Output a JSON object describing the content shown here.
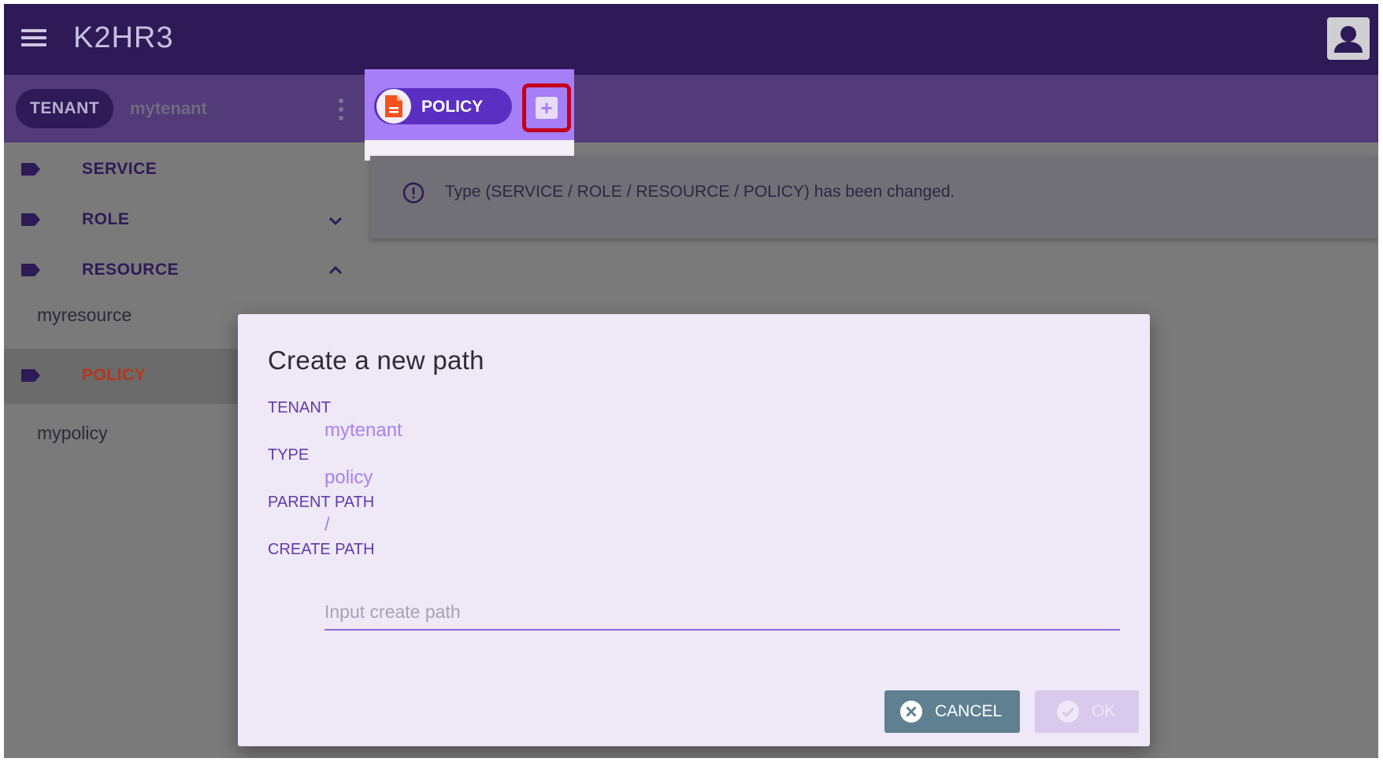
{
  "appbar": {
    "title": "K2HR3",
    "menu_icon": "hamburger-menu-icon",
    "account_icon": "account-icon"
  },
  "toolbar": {
    "tenant_chip": "TENANT",
    "tenant_name": "mytenant",
    "policy_chip": "POLICY",
    "add_icon": "add-box-icon"
  },
  "sidebar": {
    "items": [
      {
        "label": "SERVICE",
        "expand": ""
      },
      {
        "label": "ROLE",
        "expand": "chevron-down"
      },
      {
        "label": "RESOURCE",
        "expand": "chevron-up"
      },
      {
        "label": "POLICY",
        "expand": ""
      }
    ],
    "resource_children": [
      "myresource"
    ],
    "policy_children": [
      "mypolicy"
    ]
  },
  "notice": {
    "text": "Type (SERVICE / ROLE / RESOURCE / POLICY) has been changed."
  },
  "dialog": {
    "title": "Create a new path",
    "fields": [
      {
        "label": "TENANT",
        "value": "mytenant"
      },
      {
        "label": "TYPE",
        "value": "policy"
      },
      {
        "label": "PARENT PATH",
        "value": "/"
      },
      {
        "label": "CREATE PATH",
        "value": ""
      }
    ],
    "input_placeholder": "Input create path",
    "cancel_label": "CANCEL",
    "ok_label": "OK"
  },
  "colors": {
    "appbar": "#2e1a57",
    "toolbar": "#533a78",
    "accent": "#a67ef7",
    "highlight_border": "#c4001c",
    "active_nav": "#b5361a"
  }
}
